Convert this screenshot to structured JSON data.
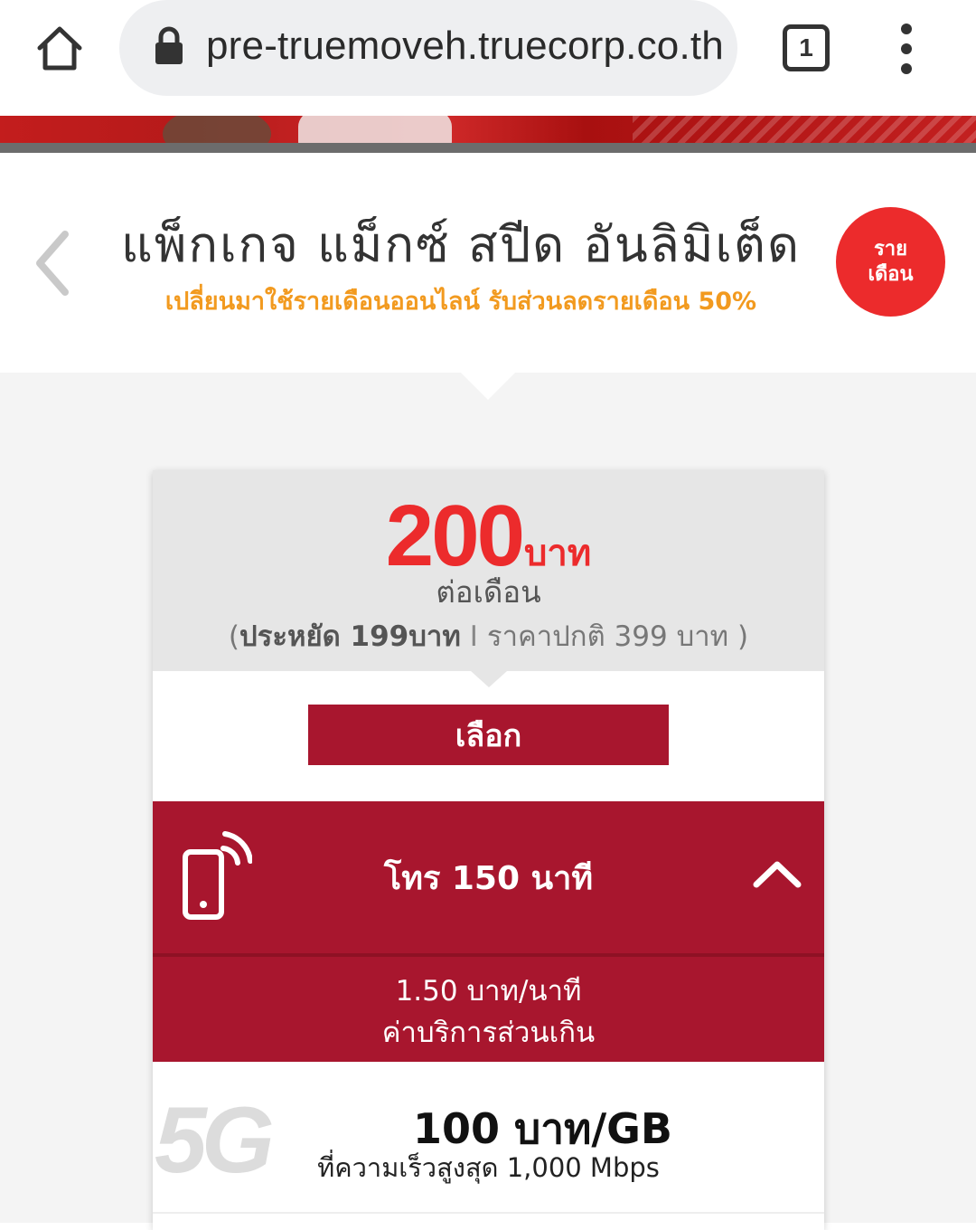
{
  "browser": {
    "url": "pre-truemoveh.truecorp.co.th",
    "tab_count": "1",
    "icons": [
      "home-icon",
      "lock-icon",
      "tabs-icon",
      "more-vert-icon"
    ]
  },
  "package": {
    "title": "แพ็กเกจ แม็กซ์ สปีด อันลิมิเต็ด",
    "subtitle": "เปลี่ยนมาใช้รายเดือนออนไลน์ รับส่วนลดรายเดือน 50%",
    "badge_line1": "ราย",
    "badge_line2": "เดือน"
  },
  "card": {
    "price": "200",
    "price_unit": "บาท",
    "per_month": "ต่อเดือน",
    "save_prefix": "(",
    "save_text": "ประหยัด 199บาท",
    "divider": "I",
    "regular_price": "ราคาปกติ 399 บาท )",
    "select_label": "เลือก",
    "call_label": "โทร 150 นาที",
    "overage_rate": "1.50 บาท/นาที",
    "overage_label": "ค่าบริการส่วนเกิน",
    "data_price": "100 บาท/GB",
    "data_speed": "ที่ความเร็วสูงสุด 1,000 Mbps",
    "data_logo": "5G"
  },
  "colors": {
    "brand_red": "#ec2b2c",
    "band_red": "#a8162e",
    "subtitle_orange": "#f29a1f"
  }
}
